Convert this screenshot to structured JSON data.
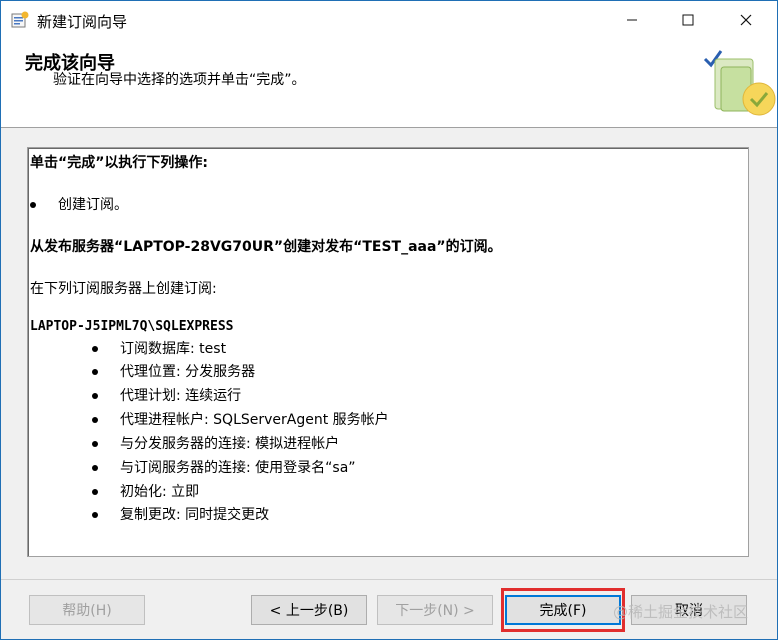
{
  "window": {
    "title": "新建订阅向导"
  },
  "header": {
    "title": "完成该向导",
    "subtitle": "验证在向导中选择的选项并单击“完成”。"
  },
  "summary": {
    "intro": "单击“完成”以执行下列操作:",
    "bullet_top": "创建订阅。",
    "publisher_line": "从发布服务器“LAPTOP-28VG70UR”创建对发布“TEST_aaa”的订阅。",
    "subscriber_intro": "在下列订阅服务器上创建订阅:",
    "server": "LAPTOP-J5IPML7Q\\SQLEXPRESS",
    "items": [
      "订阅数据库: test",
      "代理位置: 分发服务器",
      "代理计划: 连续运行",
      "代理进程帐户: SQLServerAgent 服务帐户",
      "与分发服务器的连接: 模拟进程帐户",
      "与订阅服务器的连接: 使用登录名“sa”",
      "初始化: 立即",
      "复制更改: 同时提交更改"
    ]
  },
  "buttons": {
    "help": "帮助(H)",
    "back": "< 上一步(B)",
    "next": "下一步(N) >",
    "finish": "完成(F)",
    "cancel": "取消"
  },
  "watermark": "@稀土掘金技术社区",
  "colors": {
    "highlight": "#e12e2e",
    "accent": "#0078d7"
  }
}
